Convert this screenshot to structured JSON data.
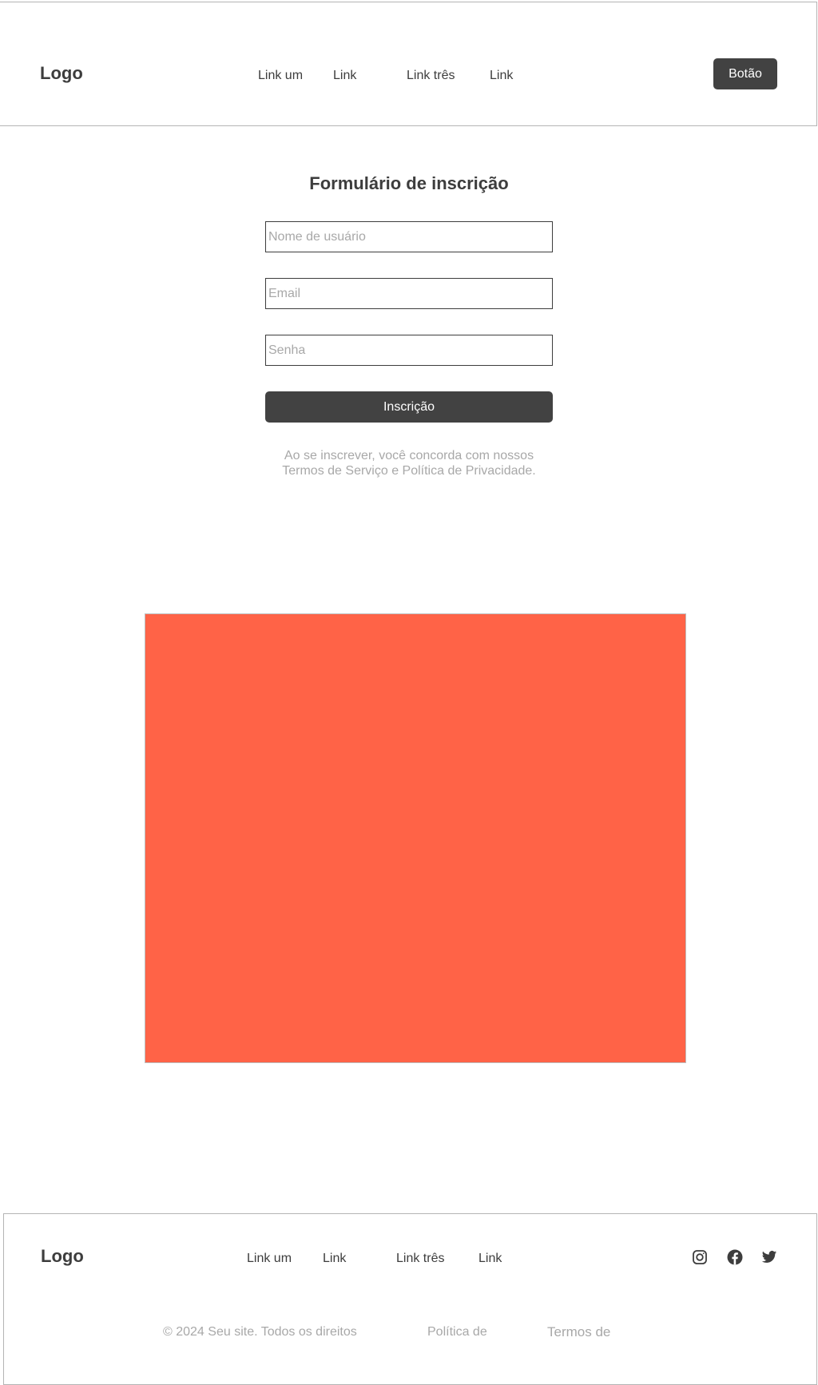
{
  "header": {
    "logo": "Logo",
    "nav": [
      "Link um",
      "Link",
      "Link três",
      "Link"
    ],
    "button_label": "Botão"
  },
  "form": {
    "title": "Formulário de inscrição",
    "username_placeholder": "Nome de usuário",
    "email_placeholder": "Email",
    "password_placeholder": "Senha",
    "submit_label": "Inscrição",
    "terms_line1": "Ao se inscrever, você concorda com nossos",
    "terms_line2": "Termos de Serviço e Política de Privacidade."
  },
  "hero": {
    "color": "#ff6347"
  },
  "footer": {
    "logo": "Logo",
    "nav": [
      "Link um",
      "Link",
      "Link três",
      "Link"
    ],
    "social_icons": [
      "instagram-icon",
      "facebook-icon",
      "twitter-icon"
    ],
    "copyright": "© 2024 Seu site. Todos os direitos",
    "privacy": "Política de",
    "terms": "Termos de"
  },
  "colors": {
    "text": "#3d3d3d",
    "muted": "#a8a8a8",
    "button": "#424242",
    "border": "#b4b4b4"
  }
}
